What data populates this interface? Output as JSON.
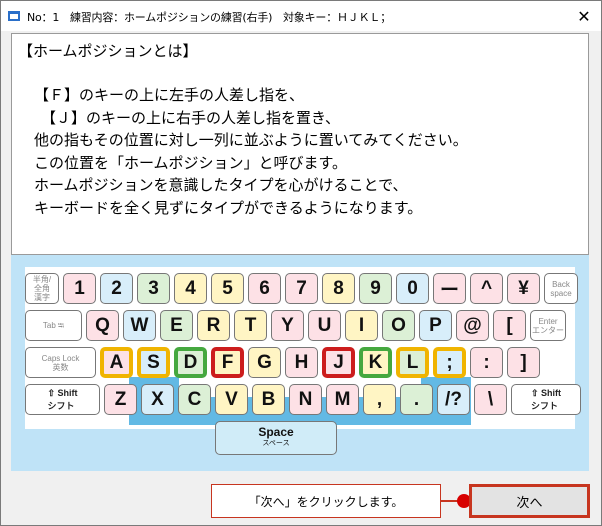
{
  "window": {
    "title": "No：1　練習内容：ホームポジションの練習(右手)　対象キー：ＨＪＫＬ；",
    "close_glyph": "✕"
  },
  "content": {
    "heading": "【ホームポジションとは】",
    "lines": [
      "【Ｆ】のキーの上に左手の人差し指を、",
      "【Ｊ】のキーの上に右手の人差し指を置き、",
      "他の指もその位置に対し一列に並ぶように置いてみてください。",
      "この位置を「ホームポジション」と呼びます。",
      "ホームポジションを意識したタイプを心がけることで、",
      "キーボードを全く見ずにタイプができるようになります。"
    ]
  },
  "keyboard": {
    "row1": [
      {
        "label": "半角/\n全角\n漢字",
        "type": "small"
      },
      {
        "label": "1",
        "color": "pink"
      },
      {
        "label": "2",
        "color": "blu"
      },
      {
        "label": "3",
        "color": "grn"
      },
      {
        "label": "4",
        "color": "yel"
      },
      {
        "label": "5",
        "color": "yel"
      },
      {
        "label": "6",
        "color": "pink"
      },
      {
        "label": "7",
        "color": "pink"
      },
      {
        "label": "8",
        "color": "yel"
      },
      {
        "label": "9",
        "color": "grn"
      },
      {
        "label": "0",
        "color": "blu"
      },
      {
        "label": "ー",
        "color": "pink"
      },
      {
        "label": "^",
        "color": "pink"
      },
      {
        "label": "¥",
        "color": "pink"
      },
      {
        "label": "Back\nspace",
        "type": "small"
      }
    ],
    "row2": [
      {
        "label": "Tab ⭾",
        "type": "small"
      },
      {
        "label": "Q",
        "color": "pink"
      },
      {
        "label": "W",
        "color": "blu"
      },
      {
        "label": "E",
        "color": "grn"
      },
      {
        "label": "R",
        "color": "yel"
      },
      {
        "label": "T",
        "color": "yel"
      },
      {
        "label": "Y",
        "color": "pink"
      },
      {
        "label": "U",
        "color": "pink"
      },
      {
        "label": "I",
        "color": "yel"
      },
      {
        "label": "O",
        "color": "grn"
      },
      {
        "label": "P",
        "color": "blu"
      },
      {
        "label": "@",
        "color": "pink"
      },
      {
        "label": "[",
        "color": "pink"
      },
      {
        "label": "Enter\nエンター",
        "type": "small"
      }
    ],
    "row3": [
      {
        "label": "Caps Lock\n英数",
        "type": "small"
      },
      {
        "label": "A",
        "color": "pink",
        "hl": "y"
      },
      {
        "label": "S",
        "color": "blu",
        "hl": "y"
      },
      {
        "label": "D",
        "color": "grn",
        "hl": "g"
      },
      {
        "label": "F",
        "color": "yel",
        "hl": "r"
      },
      {
        "label": "G",
        "color": "yel"
      },
      {
        "label": "H",
        "color": "pink"
      },
      {
        "label": "J",
        "color": "pink",
        "hl": "r"
      },
      {
        "label": "K",
        "color": "yel",
        "hl": "g"
      },
      {
        "label": "L",
        "color": "grn",
        "hl": "y"
      },
      {
        "label": ";",
        "color": "blu",
        "hl": "y"
      },
      {
        "label": ":",
        "color": "pink"
      },
      {
        "label": "]",
        "color": "pink"
      }
    ],
    "row4": [
      {
        "label": "⇧ Shift\nシフト",
        "type": "shift"
      },
      {
        "label": "Z",
        "color": "pink"
      },
      {
        "label": "X",
        "color": "blu"
      },
      {
        "label": "C",
        "color": "grn"
      },
      {
        "label": "V",
        "color": "yel"
      },
      {
        "label": "B",
        "color": "yel"
      },
      {
        "label": "N",
        "color": "pink"
      },
      {
        "label": "M",
        "color": "pink"
      },
      {
        "label": ",",
        "color": "yel"
      },
      {
        "label": ".",
        "color": "grn"
      },
      {
        "label": "/?",
        "color": "blu"
      },
      {
        "label": "\\",
        "color": "pink"
      },
      {
        "label": "⇧ Shift\nシフト",
        "type": "shift"
      }
    ],
    "space": {
      "label": "Space",
      "sub": "スペース"
    }
  },
  "footer": {
    "caption": "「次へ」をクリックします。",
    "next_label": "次へ"
  },
  "colors": {
    "pink": "#fde1e6",
    "yellow": "#fff5c4",
    "green": "#dcf0d6",
    "blue": "#d8eefa",
    "highlight_red": "#cc1d1d",
    "highlight_green": "#45a83f",
    "highlight_yellow": "#f0b400"
  },
  "icons": [
    "app-icon",
    "close-icon"
  ]
}
